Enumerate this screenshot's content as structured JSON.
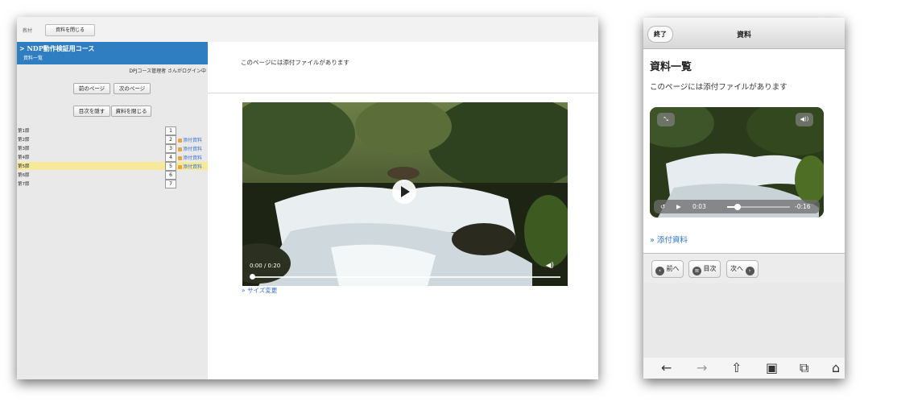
{
  "desktop": {
    "toolbar": {
      "label": "教材",
      "close_button": "資料を閉じる"
    },
    "sidebar": {
      "course_title": "> NDP動作検証用コース",
      "section_title": "資料一覧",
      "login_text": "DPJコース管理者 さんがログイン中",
      "prev_page": "前のページ",
      "next_page": "次のページ",
      "hide_toc": "目次を隠す",
      "close_material": "資料を閉じる",
      "sections": [
        {
          "name": "第1節",
          "num": "1",
          "attachment": ""
        },
        {
          "name": "第2節",
          "num": "2",
          "attachment": "添付資料"
        },
        {
          "name": "第3節",
          "num": "3",
          "attachment": "添付資料"
        },
        {
          "name": "第4節",
          "num": "4",
          "attachment": "添付資料"
        },
        {
          "name": "第5節",
          "num": "5",
          "attachment": "添付資料",
          "selected": true
        },
        {
          "name": "第6節",
          "num": "6",
          "attachment": ""
        },
        {
          "name": "第7節",
          "num": "7",
          "attachment": ""
        }
      ]
    },
    "main": {
      "notice": "このページには添付ファイルがあります",
      "video_time": "0:00 / 0:20",
      "resize_link": "» サイズ変更"
    }
  },
  "phone": {
    "end_button": "終了",
    "title": "資料",
    "heading": "資料一覧",
    "notice": "このページには添付ファイルがあります",
    "video": {
      "elapsed": "0:03",
      "remaining": "-0:16"
    },
    "attachment_link": "» 添付資料",
    "pager": {
      "prev": "前へ",
      "toc": "目次",
      "next": "次へ"
    }
  },
  "colors": {
    "accent_blue": "#2f7ec2",
    "selected_row": "#f6e99a",
    "link": "#3a6fd1"
  },
  "icons": [
    "play-icon",
    "volume-icon",
    "expand-icon",
    "replay-icon",
    "back-arrow-icon",
    "forward-arrow-icon",
    "share-icon",
    "bookmark-folder-icon",
    "tabs-icon",
    "home-icon"
  ]
}
